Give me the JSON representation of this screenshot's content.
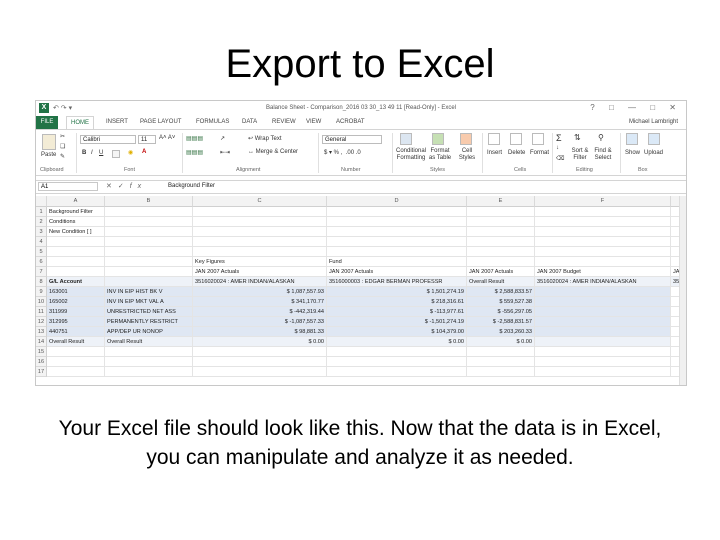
{
  "slide": {
    "title": "Export to Excel",
    "caption": "Your Excel file should look like this. Now that the data is in Excel, you can manipulate and analyze it as needed."
  },
  "window": {
    "title": "Balance Sheet - Comparison_2016 03 30_13 49 11 [Read-Only] - Excel",
    "user": "Michael Lambright"
  },
  "ribbon_tabs": [
    "FILE",
    "HOME",
    "INSERT",
    "PAGE LAYOUT",
    "FORMULAS",
    "DATA",
    "REVIEW",
    "VIEW",
    "ACROBAT"
  ],
  "ribbon": {
    "font_name": "Calibri",
    "font_size": "11",
    "number_format": "General",
    "paste": "Paste",
    "wrap_text": "Wrap Text",
    "merge_center": "Merge & Center",
    "conditional": "Conditional Formatting",
    "format_table": "Format as Table",
    "cell_styles": "Cell Styles",
    "insert": "Insert",
    "delete": "Delete",
    "format": "Format",
    "sort_filter": "Sort & Filter",
    "find_select": "Find & Select",
    "show": "Show",
    "upload": "Upload",
    "groups": [
      "Clipboard",
      "Font",
      "Alignment",
      "Number",
      "Styles",
      "Cells",
      "Editing",
      "Box"
    ]
  },
  "formula_bar": {
    "name_box": "A1",
    "value": "Background Filter"
  },
  "columns": [
    "A",
    "B",
    "C",
    "D",
    "E",
    "F"
  ],
  "rows": [
    {
      "n": "1",
      "a": "Background Filter",
      "b": "",
      "c": "",
      "d": "",
      "e": "",
      "f": ""
    },
    {
      "n": "2",
      "a": "Conditions",
      "b": "",
      "c": "",
      "d": "",
      "e": "",
      "f": ""
    },
    {
      "n": "3",
      "a": "New Condition [ ]",
      "b": "",
      "c": "",
      "d": "",
      "e": "",
      "f": ""
    },
    {
      "n": "4",
      "a": "",
      "b": "",
      "c": "",
      "d": "",
      "e": "",
      "f": ""
    },
    {
      "n": "5",
      "a": "",
      "b": "",
      "c": "",
      "d": "",
      "e": "",
      "f": ""
    },
    {
      "n": "6",
      "a": "",
      "b": "",
      "c": "Key Figures",
      "d": "Fund",
      "e": "",
      "f": ""
    },
    {
      "n": "7",
      "a": "",
      "b": "",
      "c": "JAN 2007 Actuals",
      "d": "JAN 2007 Actuals",
      "e": "JAN 2007 Actuals",
      "f": "JAN 2007 Budget"
    },
    {
      "n": "8",
      "a": "G/L Account",
      "b": "",
      "c": "3516020024 : AMER INDIAN/ALASKAN",
      "d": "3516000003 : EDGAR BERMAN PROFESSR",
      "e": "Overall Result",
      "f": "3516020024 : AMER INDIAN/ALASKAN"
    },
    {
      "n": "9",
      "a": "163001",
      "b": "INV IN EIP HIST BK V",
      "c": "$ 1,087,557.93",
      "d": "$ 1,501,274.19",
      "e": "$ 2,588,833.57",
      "f": ""
    },
    {
      "n": "10",
      "a": "165002",
      "b": "INV IN EIP MKT VAL A",
      "c": "$ 341,170.77",
      "d": "$ 218,316.61",
      "e": "$ 559,527.38",
      "f": ""
    },
    {
      "n": "11",
      "a": "311999",
      "b": "UNRESTRICTED NET ASS",
      "c": "$ -442,319.44",
      "d": "$ -113,977.61",
      "e": "$ -556,297.05",
      "f": ""
    },
    {
      "n": "12",
      "a": "312995",
      "b": "PERMANENTLY RESTRICT",
      "c": "$ -1,087,557.33",
      "d": "$ -1,501,274.19",
      "e": "$ -2,588,831.57",
      "f": ""
    },
    {
      "n": "13",
      "a": "440751",
      "b": "APP/DEP UR NONOP",
      "c": "$ 98,881.33",
      "d": "$ 104,379.00",
      "e": "$ 203,260.33",
      "f": ""
    },
    {
      "n": "14",
      "a": "Overall Result",
      "b": "Overall Result",
      "c": "$ 0.00",
      "d": "$ 0.00",
      "e": "$ 0.00",
      "f": ""
    },
    {
      "n": "15",
      "a": "",
      "b": "",
      "c": "",
      "d": "",
      "e": "",
      "f": ""
    },
    {
      "n": "16",
      "a": "",
      "b": "",
      "c": "",
      "d": "",
      "e": "",
      "f": ""
    },
    {
      "n": "17",
      "a": "",
      "b": "",
      "c": "",
      "d": "",
      "e": "",
      "f": ""
    }
  ],
  "extra_col_g": {
    "r7": "JA",
    "r8": "35"
  },
  "colors": {
    "excel_green": "#217346",
    "highlight": "#dfe7f3"
  }
}
